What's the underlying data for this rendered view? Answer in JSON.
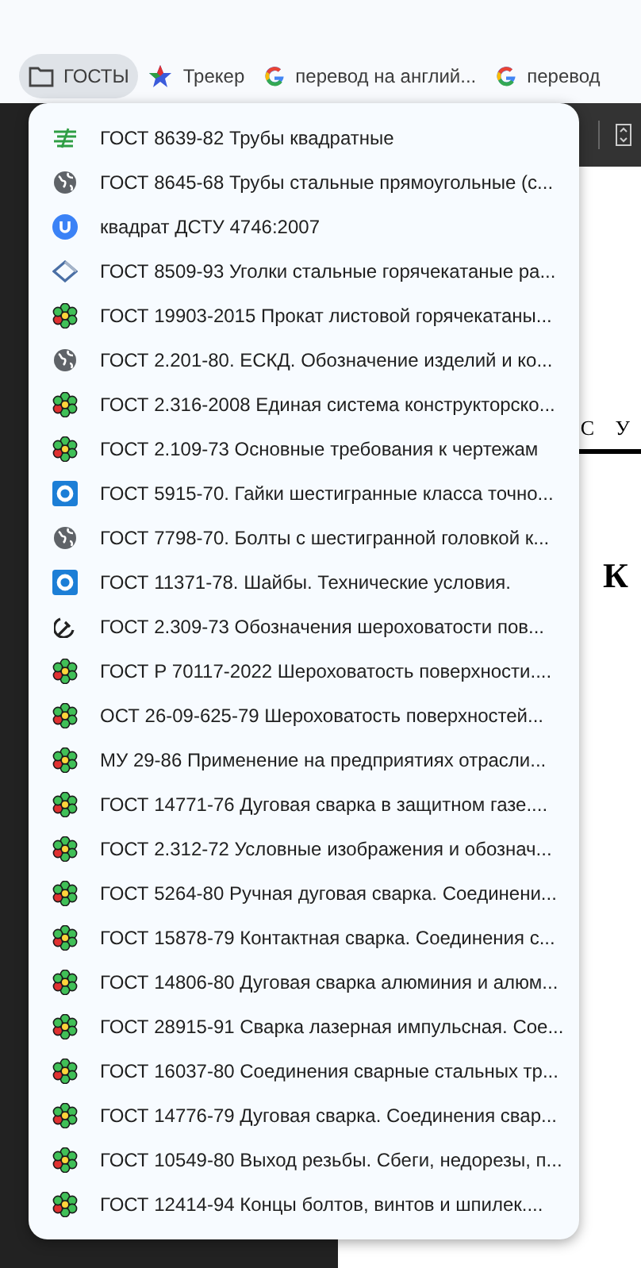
{
  "bookmarks_bar": {
    "items": [
      {
        "label": "ГОСТЫ",
        "kind": "folder",
        "selected": true
      },
      {
        "label": "Трекер",
        "kind": "star",
        "selected": false
      },
      {
        "label": "перевод на англий...",
        "kind": "g",
        "selected": false
      },
      {
        "label": "перевод",
        "kind": "g",
        "selected": false
      }
    ]
  },
  "document": {
    "heading_fragment": "С У",
    "title_fragment": "К"
  },
  "folder_menu": {
    "items": [
      {
        "label": "ГОСТ 8639-82 Трубы квадратные",
        "kind": "stripes"
      },
      {
        "label": "ГОСТ 8645-68 Трубы стальные прямоугольные (с...",
        "kind": "globe"
      },
      {
        "label": "квадрат ДСТУ 4746:2007",
        "kind": "u"
      },
      {
        "label": "ГОСТ 8509-93 Уголки стальные горячекатаные ра...",
        "kind": "diamond"
      },
      {
        "label": "ГОСТ 19903-2015 Прокат листовой горячекатаны...",
        "kind": "flower"
      },
      {
        "label": "ГОСТ 2.201-80. ЕСКД. Обозначение изделий и ко...",
        "kind": "globe"
      },
      {
        "label": "ГОСТ 2.316-2008 Единая система конструкторско...",
        "kind": "flower"
      },
      {
        "label": "ГОСТ 2.109-73 Основные требования к чертежам",
        "kind": "flower"
      },
      {
        "label": "ГОСТ 5915-70. Гайки шестигранные класса точно...",
        "kind": "ring"
      },
      {
        "label": "ГОСТ 7798-70. Болты с шестигранной головкой к...",
        "kind": "globe"
      },
      {
        "label": "ГОСТ 11371-78. Шайбы. Технические условия.",
        "kind": "ring"
      },
      {
        "label": "ГОСТ 2.309-73  Обозначения шероховатости пов...",
        "kind": "sickle"
      },
      {
        "label": "ГОСТ Р 70117-2022 Шероховатость поверхности....",
        "kind": "flower"
      },
      {
        "label": "ОСТ 26-09-625-79 Шероховатость поверхностей...",
        "kind": "flower"
      },
      {
        "label": "МУ 29-86 Применение на предприятиях отрасли...",
        "kind": "flower"
      },
      {
        "label": "ГОСТ 14771-76 Дуговая сварка в защитном газе....",
        "kind": "flower"
      },
      {
        "label": "ГОСТ 2.312-72 Условные изображения и обознач...",
        "kind": "flower"
      },
      {
        "label": "ГОСТ 5264-80 Ручная дуговая сварка. Соединени...",
        "kind": "flower"
      },
      {
        "label": "ГОСТ 15878-79 Контактная сварка. Соединения с...",
        "kind": "flower"
      },
      {
        "label": "ГОСТ 14806-80 Дуговая сварка алюминия и алюм...",
        "kind": "flower"
      },
      {
        "label": "ГОСТ 28915-91 Сварка лазерная импульсная. Сое...",
        "kind": "flower"
      },
      {
        "label": "ГОСТ 16037-80 Соединения сварные стальных тр...",
        "kind": "flower"
      },
      {
        "label": "ГОСТ 14776-79 Дуговая сварка. Соединения свар...",
        "kind": "flower"
      },
      {
        "label": "ГОСТ 10549-80 Выход резьбы. Сбеги, недорезы, п...",
        "kind": "flower"
      },
      {
        "label": "ГОСТ 12414-94 Концы болтов, винтов и шпилек....",
        "kind": "flower"
      }
    ]
  }
}
